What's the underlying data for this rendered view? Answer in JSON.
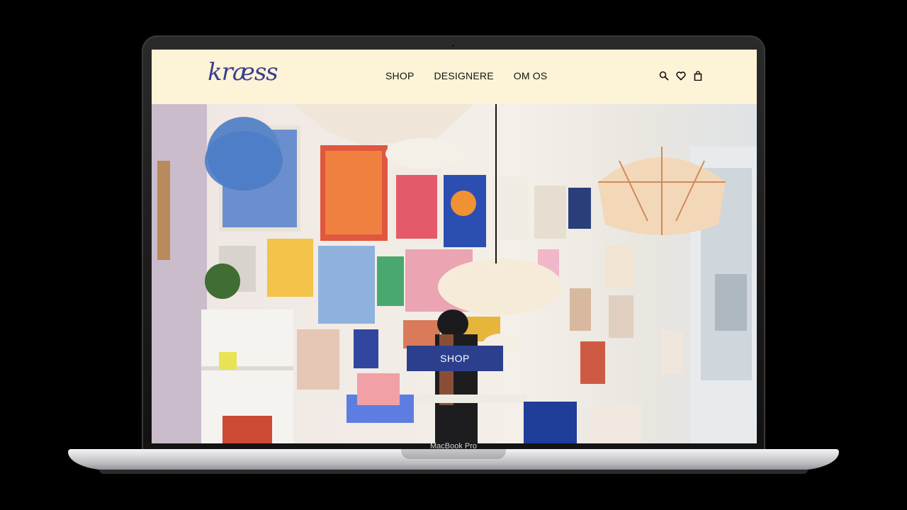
{
  "site": {
    "logo_text": "kræss"
  },
  "nav": {
    "items": [
      {
        "label": "SHOP"
      },
      {
        "label": "DESIGNERE"
      },
      {
        "label": "OM OS"
      }
    ]
  },
  "header_icons": [
    "search-icon",
    "heart-icon",
    "bag-icon"
  ],
  "hero": {
    "button_label": "SHOP"
  },
  "device": {
    "label": "MacBook Pro"
  },
  "colors": {
    "header_bg": "#fdf3d6",
    "logo": "#3a3f8f",
    "button_bg": "#2c3f8c"
  }
}
